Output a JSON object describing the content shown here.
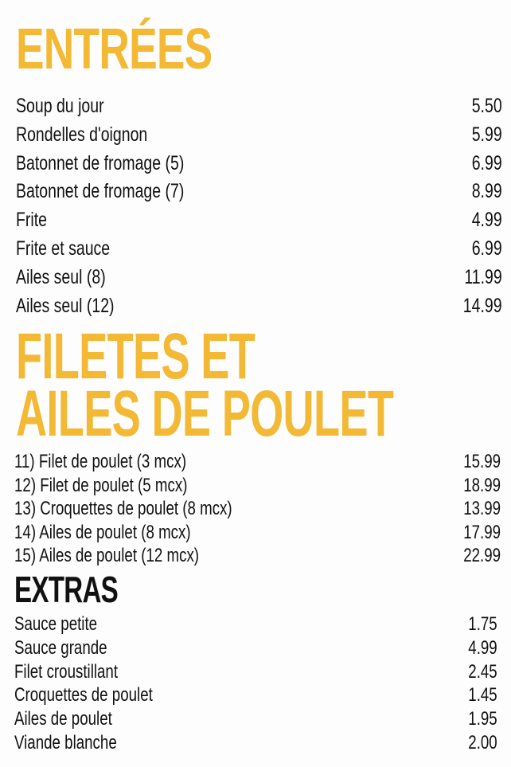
{
  "sections": {
    "entrees": {
      "title": "ENTRÉES",
      "items": [
        {
          "name": "Soup du jour",
          "price": "5.50"
        },
        {
          "name": "Rondelles d'oignon",
          "price": "5.99"
        },
        {
          "name": "Batonnet de fromage (5)",
          "price": "6.99"
        },
        {
          "name": "Batonnet de fromage (7)",
          "price": "8.99"
        },
        {
          "name": "Frite",
          "price": "4.99"
        },
        {
          "name": "Frite et sauce",
          "price": "6.99"
        },
        {
          "name": "Ailes seul (8)",
          "price": "11.99"
        },
        {
          "name": "Ailes seul (12)",
          "price": "14.99"
        }
      ]
    },
    "filets": {
      "title_line1": "FILETES ET",
      "title_line2": "AILES DE POULET",
      "items": [
        {
          "name": "11) Filet de poulet (3 mcx)",
          "price": "15.99"
        },
        {
          "name": "12) Filet de poulet (5 mcx)",
          "price": "18.99"
        },
        {
          "name": "13) Croquettes de poulet (8 mcx)",
          "price": "13.99"
        },
        {
          "name": "14) Ailes de poulet (8 mcx)",
          "price": "17.99"
        },
        {
          "name": "15) Ailes de poulet (12 mcx)",
          "price": "22.99"
        }
      ]
    },
    "extras": {
      "title": "EXTRAS",
      "items": [
        {
          "name": "Sauce petite",
          "price": "1.75"
        },
        {
          "name": "Sauce grande",
          "price": "4.99"
        },
        {
          "name": "Filet croustillant",
          "price": "2.45"
        },
        {
          "name": "Croquettes de poulet",
          "price": "1.45"
        },
        {
          "name": "Ailes de poulet",
          "price": "1.95"
        },
        {
          "name": "Viande blanche",
          "price": "2.00"
        }
      ]
    }
  },
  "colors": {
    "heading_accent": "#f3b935",
    "text": "#111111",
    "background": "#fdfdfd"
  }
}
